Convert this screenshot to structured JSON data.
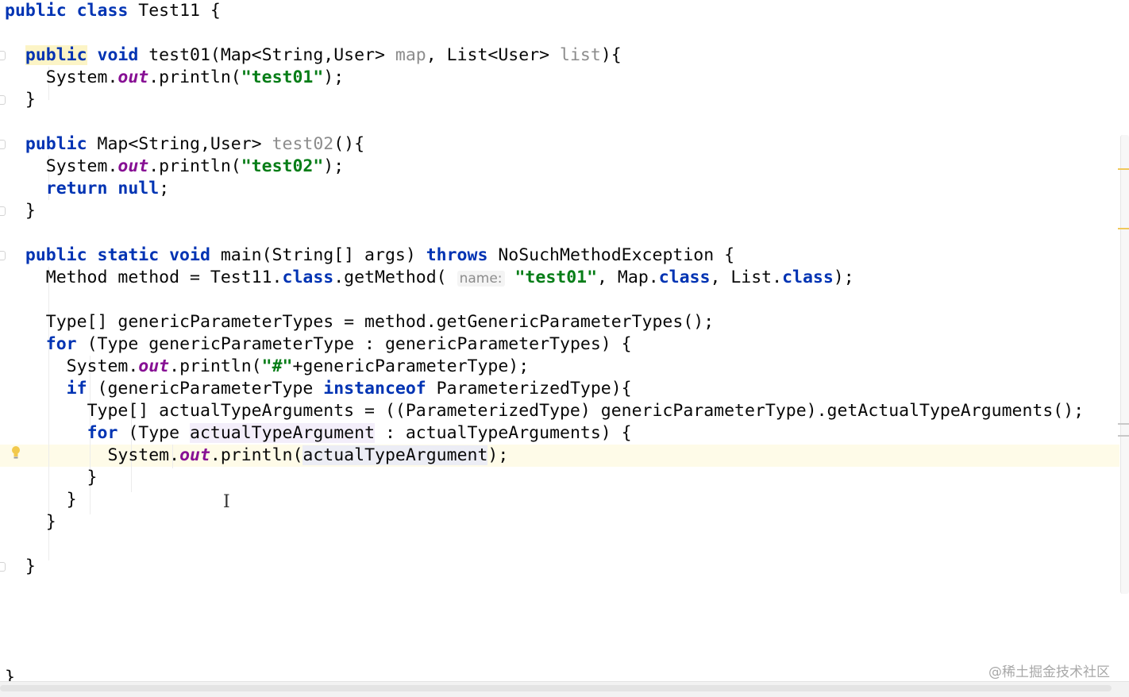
{
  "code": {
    "l1": {
      "kw": "public class",
      "rest": " Test11 {"
    },
    "l3": {
      "indent": "  ",
      "kw1": "public",
      "sp": " ",
      "kw2": "void",
      "sig": " test01(Map<String,User> ",
      "p1": "map",
      "mid": ", List<User> ",
      "p2": "list",
      "end": "){"
    },
    "l4": {
      "indent": "    ",
      "pre": "System.",
      "field": "out",
      "post": ".println(",
      "str": "\"test01\"",
      "end": ");"
    },
    "l5": {
      "text": "  }"
    },
    "l7": {
      "indent": "  ",
      "kw": "public",
      "sig": " Map<String,User> ",
      "name": "test02",
      "end": "(){"
    },
    "l8": {
      "indent": "    ",
      "pre": "System.",
      "field": "out",
      "post": ".println(",
      "str": "\"test02\"",
      "end": ");"
    },
    "l9": {
      "indent": "    ",
      "kw1": "return",
      "sp": " ",
      "kw2": "null",
      "end": ";"
    },
    "l10": {
      "text": "  }"
    },
    "l12": {
      "indent": "  ",
      "kw": "public static void",
      "sig": " main(String[] args) ",
      "kw2": "throws",
      "end": " NoSuchMethodException {"
    },
    "l13": {
      "indent": "    ",
      "pre": "Method method = Test11.",
      "kw1": "class",
      "mid1": ".getMethod( ",
      "hint": "name:",
      "sp": " ",
      "str": "\"test01\"",
      "mid2": ", Map.",
      "kw2": "class",
      "mid3": ", List.",
      "kw3": "class",
      "end": ");"
    },
    "l15": {
      "indent": "    ",
      "text": "Type[] genericParameterTypes = method.getGenericParameterTypes();"
    },
    "l16": {
      "indent": "    ",
      "kw": "for",
      "rest": " (Type genericParameterType : genericParameterTypes) {"
    },
    "l17": {
      "indent": "      ",
      "pre": "System.",
      "field": "out",
      "post": ".println(",
      "str": "\"#\"",
      "end": "+genericParameterType);"
    },
    "l18": {
      "indent": "      ",
      "kw1": "if",
      "mid": " (genericParameterType ",
      "kw2": "instanceof",
      "end": " ParameterizedType){"
    },
    "l19": {
      "indent": "        ",
      "text": "Type[] actualTypeArguments = ((ParameterizedType) genericParameterType).getActualTypeArguments();"
    },
    "l20": {
      "indent": "        ",
      "kw": "for",
      "pre": " (Type ",
      "var": "actualTypeArgument",
      "end": " : actualTypeArguments) {"
    },
    "l21": {
      "indent": "          ",
      "pre": "System.",
      "field": "out",
      "post": ".println(",
      "var": "actualTypeArgument",
      "end": ");"
    },
    "l22": {
      "text": "        }"
    },
    "l23": {
      "text": "      }"
    },
    "l24": {
      "text": "    }"
    },
    "l26": {
      "text": "  }"
    },
    "l30": {
      "text": "}"
    }
  },
  "icons": {
    "intention": "lightbulb-icon",
    "cursor": "text-cursor-icon"
  },
  "watermark": "@稀土掘金技术社区",
  "colors": {
    "keyword": "#0033b3",
    "string": "#067d17",
    "static_field": "#871094",
    "unused": "#8c8c8c",
    "caret_row": "#fefbe8",
    "warning_stripe": "#f0c85a"
  }
}
